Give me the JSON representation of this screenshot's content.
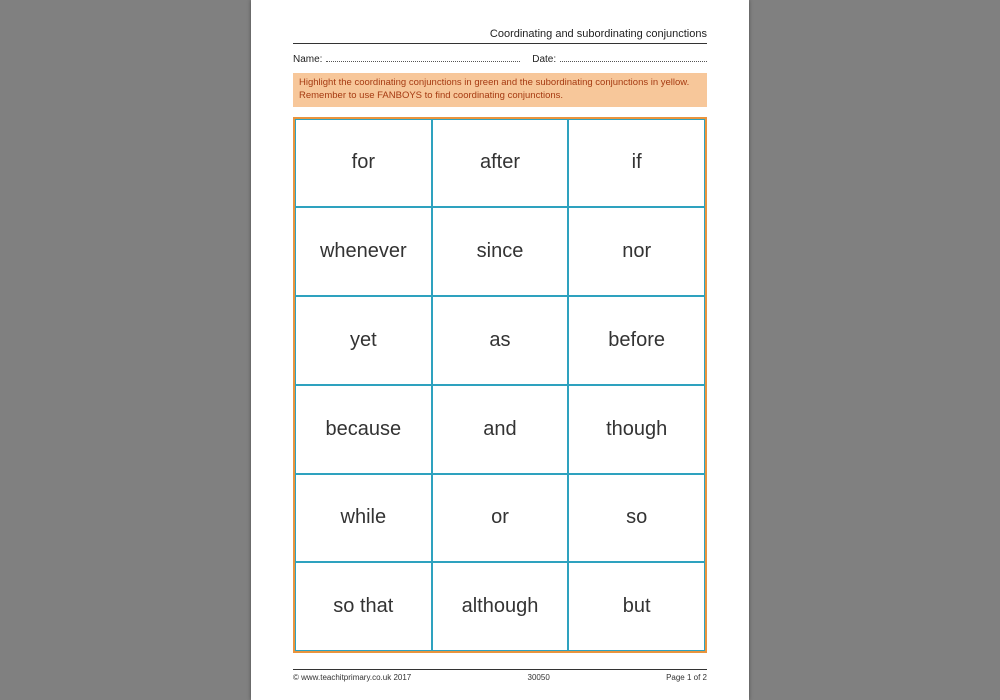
{
  "header": {
    "title": "Coordinating and subordinating conjunctions",
    "name_label": "Name:",
    "date_label": "Date:"
  },
  "instructions": "Highlight the coordinating conjunctions in green and the subordinating conjunctions in yellow. Remember to use FANBOYS to find coordinating conjunctions.",
  "grid": {
    "rows": [
      [
        "for",
        "after",
        "if"
      ],
      [
        "whenever",
        "since",
        "nor"
      ],
      [
        "yet",
        "as",
        "before"
      ],
      [
        "because",
        "and",
        "though"
      ],
      [
        "while",
        "or",
        "so"
      ],
      [
        "so that",
        "although",
        "but"
      ]
    ]
  },
  "footer": {
    "copyright": "© www.teachitprimary.co.uk 2017",
    "code": "30050",
    "page": "Page 1 of 2"
  }
}
